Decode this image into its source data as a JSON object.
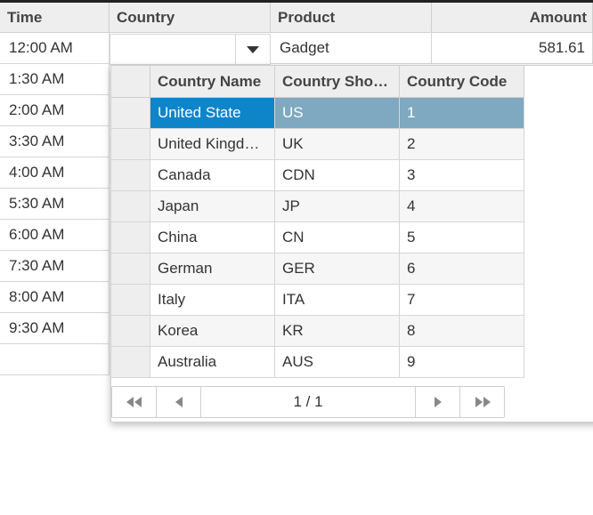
{
  "main_grid": {
    "headers": [
      "Time",
      "Country",
      "Product",
      "Amount"
    ],
    "rows": [
      {
        "time": "12:00 AM",
        "product": "Gadget",
        "amount": "581.61"
      },
      {
        "time": "1:30 AM"
      },
      {
        "time": "2:00 AM"
      },
      {
        "time": "3:30 AM"
      },
      {
        "time": "4:00 AM"
      },
      {
        "time": "5:30 AM"
      },
      {
        "time": "6:00 AM"
      },
      {
        "time": "7:30 AM"
      },
      {
        "time": "8:00 AM"
      },
      {
        "time": "9:30 AM"
      }
    ]
  },
  "country_dropdown": {
    "headers": [
      "Country Name",
      "Country Sho…",
      "Country Code"
    ],
    "rows": [
      [
        "United State",
        "US",
        "1"
      ],
      [
        "United Kingd…",
        "UK",
        "2"
      ],
      [
        "Canada",
        "CDN",
        "3"
      ],
      [
        "Japan",
        "JP",
        "4"
      ],
      [
        "China",
        "CN",
        "5"
      ],
      [
        "German",
        "GER",
        "6"
      ],
      [
        "Italy",
        "ITA",
        "7"
      ],
      [
        "Korea",
        "KR",
        "8"
      ],
      [
        "Australia",
        "AUS",
        "9"
      ]
    ],
    "pager": {
      "page_info": "1 / 1",
      "first_icon": "first-page-icon",
      "prev_icon": "prev-page-icon",
      "next_icon": "next-page-icon",
      "last_icon": "last-page-icon"
    }
  },
  "colors": {
    "selected_cell": "#0e85c9",
    "selected_row": "#7ea9c0",
    "header_bg": "#eeeeee"
  }
}
